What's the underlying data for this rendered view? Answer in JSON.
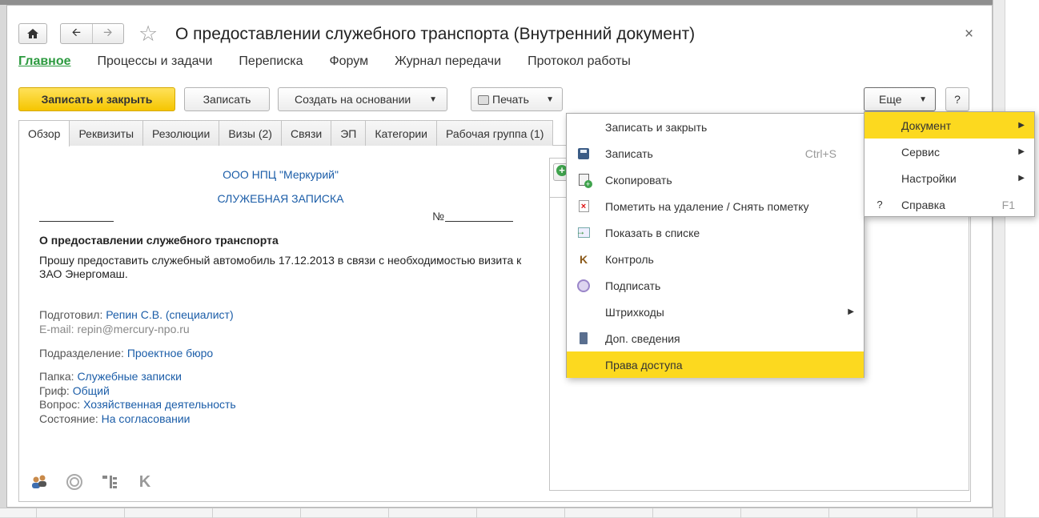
{
  "window": {
    "title": "О предоставлении служебного транспорта (Внутренний документ)",
    "close_label": "×"
  },
  "nav": {
    "items": [
      "Главное",
      "Процессы и задачи",
      "Переписка",
      "Форум",
      "Журнал передачи",
      "Протокол работы"
    ]
  },
  "toolbar": {
    "save_close": "Записать и закрыть",
    "save": "Записать",
    "create_based": "Создать на основании",
    "print": "Печать",
    "more": "Еще",
    "help": "?"
  },
  "tabs": [
    "Обзор",
    "Реквизиты",
    "Резолюции",
    "Визы (2)",
    "Связи",
    "ЭП",
    "Категории",
    "Рабочая группа (1)"
  ],
  "document": {
    "org": "ООО НПЦ \"Меркурий\"",
    "memo_type": "СЛУЖЕБНАЯ ЗАПИСКА",
    "number_label": "№",
    "subject": "О предоставлении служебного транспорта",
    "body": "Прошу предоставить служебный автомобиль 17.12.2013 в связи с необходимостью визита к ЗАО Энергомаш.",
    "prepared_label": "Подготовил:",
    "prepared_value": "Репин С.В. (специалист)",
    "email": "E-mail: repin@mercury-npo.ru",
    "division_label": "Подразделение:",
    "division_value": "Проектное бюро",
    "folder_label": "Папка:",
    "folder_value": "Служебные записки",
    "grif_label": "Гриф:",
    "grif_value": "Общий",
    "question_label": "Вопрос:",
    "question_value": "Хозяйственная деятельность",
    "state_label": "Состояние:",
    "state_value": "На согласовании"
  },
  "menu_main": {
    "items": [
      {
        "label": "Записать и закрыть",
        "shortcut": "",
        "icon": "none"
      },
      {
        "label": "Записать",
        "shortcut": "Ctrl+S",
        "icon": "disk-icon"
      },
      {
        "label": "Скопировать",
        "shortcut": "",
        "icon": "copy-icon"
      },
      {
        "label": "Пометить на удаление / Снять пометку",
        "shortcut": "",
        "icon": "delete-mark-icon"
      },
      {
        "label": "Показать в списке",
        "shortcut": "",
        "icon": "show-in-list-icon"
      },
      {
        "label": "Контроль",
        "shortcut": "",
        "icon": "control-k-icon"
      },
      {
        "label": "Подписать",
        "shortcut": "",
        "icon": "sign-icon"
      },
      {
        "label": "Штрихкоды",
        "shortcut": "",
        "icon": "none",
        "submenu": true
      },
      {
        "label": "Доп. сведения",
        "shortcut": "",
        "icon": "info-icon"
      },
      {
        "label": "Права доступа",
        "shortcut": "",
        "icon": "none",
        "highlighted": true
      }
    ]
  },
  "menu_sub": {
    "items": [
      {
        "label": "Документ",
        "shortcut": "",
        "submenu": true,
        "highlighted": true
      },
      {
        "label": "Сервис",
        "shortcut": "",
        "submenu": true
      },
      {
        "label": "Настройки",
        "shortcut": "",
        "submenu": true
      },
      {
        "label": "Справка",
        "shortcut": "F1",
        "icon_text": "?"
      }
    ]
  },
  "colors": {
    "accent_yellow": "#fcd91f",
    "link_blue": "#1b5da8",
    "nav_green": "#2c9a3f"
  }
}
